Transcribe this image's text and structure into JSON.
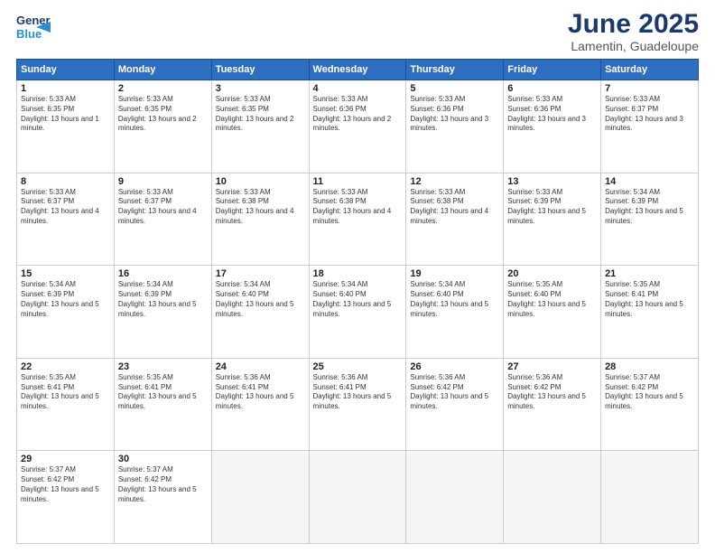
{
  "logo": {
    "general": "General",
    "blue": "Blue"
  },
  "title": "June 2025",
  "subtitle": "Lamentin, Guadeloupe",
  "days_of_week": [
    "Sunday",
    "Monday",
    "Tuesday",
    "Wednesday",
    "Thursday",
    "Friday",
    "Saturday"
  ],
  "weeks": [
    [
      {
        "day": "1",
        "rise": "5:33 AM",
        "set": "6:35 PM",
        "hours": "13 hours and 1 minute."
      },
      {
        "day": "2",
        "rise": "5:33 AM",
        "set": "6:35 PM",
        "hours": "13 hours and 2 minutes."
      },
      {
        "day": "3",
        "rise": "5:33 AM",
        "set": "6:35 PM",
        "hours": "13 hours and 2 minutes."
      },
      {
        "day": "4",
        "rise": "5:33 AM",
        "set": "6:36 PM",
        "hours": "13 hours and 2 minutes."
      },
      {
        "day": "5",
        "rise": "5:33 AM",
        "set": "6:36 PM",
        "hours": "13 hours and 3 minutes."
      },
      {
        "day": "6",
        "rise": "5:33 AM",
        "set": "6:36 PM",
        "hours": "13 hours and 3 minutes."
      },
      {
        "day": "7",
        "rise": "5:33 AM",
        "set": "6:37 PM",
        "hours": "13 hours and 3 minutes."
      }
    ],
    [
      {
        "day": "8",
        "rise": "5:33 AM",
        "set": "6:37 PM",
        "hours": "13 hours and 4 minutes."
      },
      {
        "day": "9",
        "rise": "5:33 AM",
        "set": "6:37 PM",
        "hours": "13 hours and 4 minutes."
      },
      {
        "day": "10",
        "rise": "5:33 AM",
        "set": "6:38 PM",
        "hours": "13 hours and 4 minutes."
      },
      {
        "day": "11",
        "rise": "5:33 AM",
        "set": "6:38 PM",
        "hours": "13 hours and 4 minutes."
      },
      {
        "day": "12",
        "rise": "5:33 AM",
        "set": "6:38 PM",
        "hours": "13 hours and 4 minutes."
      },
      {
        "day": "13",
        "rise": "5:33 AM",
        "set": "6:39 PM",
        "hours": "13 hours and 5 minutes."
      },
      {
        "day": "14",
        "rise": "5:34 AM",
        "set": "6:39 PM",
        "hours": "13 hours and 5 minutes."
      }
    ],
    [
      {
        "day": "15",
        "rise": "5:34 AM",
        "set": "6:39 PM",
        "hours": "13 hours and 5 minutes."
      },
      {
        "day": "16",
        "rise": "5:34 AM",
        "set": "6:39 PM",
        "hours": "13 hours and 5 minutes."
      },
      {
        "day": "17",
        "rise": "5:34 AM",
        "set": "6:40 PM",
        "hours": "13 hours and 5 minutes."
      },
      {
        "day": "18",
        "rise": "5:34 AM",
        "set": "6:40 PM",
        "hours": "13 hours and 5 minutes."
      },
      {
        "day": "19",
        "rise": "5:34 AM",
        "set": "6:40 PM",
        "hours": "13 hours and 5 minutes."
      },
      {
        "day": "20",
        "rise": "5:35 AM",
        "set": "6:40 PM",
        "hours": "13 hours and 5 minutes."
      },
      {
        "day": "21",
        "rise": "5:35 AM",
        "set": "6:41 PM",
        "hours": "13 hours and 5 minutes."
      }
    ],
    [
      {
        "day": "22",
        "rise": "5:35 AM",
        "set": "6:41 PM",
        "hours": "13 hours and 5 minutes."
      },
      {
        "day": "23",
        "rise": "5:35 AM",
        "set": "6:41 PM",
        "hours": "13 hours and 5 minutes."
      },
      {
        "day": "24",
        "rise": "5:36 AM",
        "set": "6:41 PM",
        "hours": "13 hours and 5 minutes."
      },
      {
        "day": "25",
        "rise": "5:36 AM",
        "set": "6:41 PM",
        "hours": "13 hours and 5 minutes."
      },
      {
        "day": "26",
        "rise": "5:36 AM",
        "set": "6:42 PM",
        "hours": "13 hours and 5 minutes."
      },
      {
        "day": "27",
        "rise": "5:36 AM",
        "set": "6:42 PM",
        "hours": "13 hours and 5 minutes."
      },
      {
        "day": "28",
        "rise": "5:37 AM",
        "set": "6:42 PM",
        "hours": "13 hours and 5 minutes."
      }
    ],
    [
      {
        "day": "29",
        "rise": "5:37 AM",
        "set": "6:42 PM",
        "hours": "13 hours and 5 minutes."
      },
      {
        "day": "30",
        "rise": "5:37 AM",
        "set": "6:42 PM",
        "hours": "13 hours and 5 minutes."
      },
      null,
      null,
      null,
      null,
      null
    ]
  ]
}
